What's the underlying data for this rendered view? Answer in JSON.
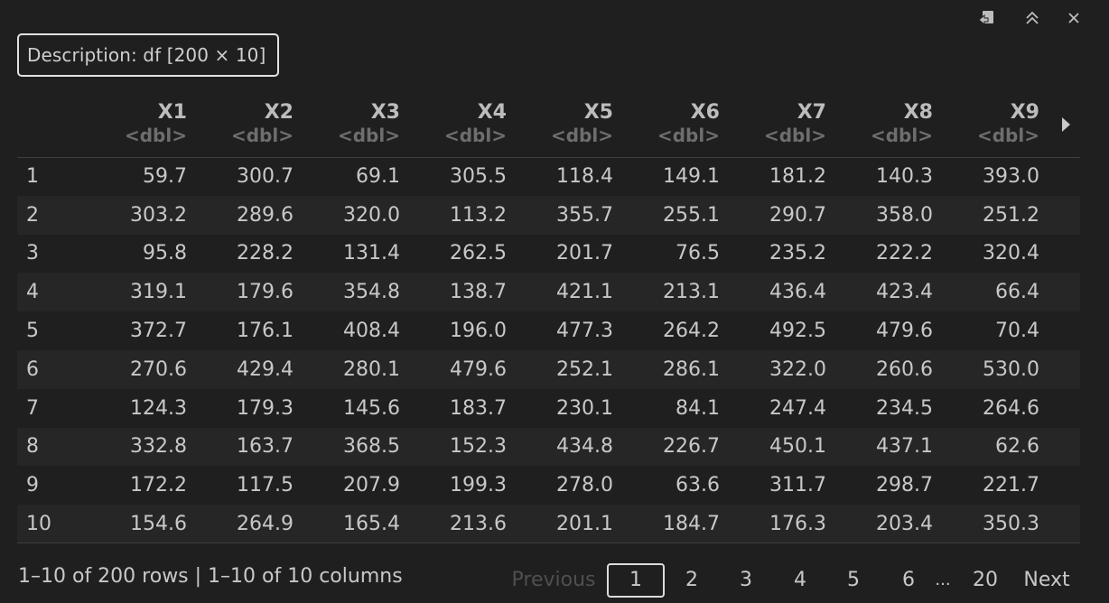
{
  "toolbar": {
    "icons": [
      "export-icon",
      "collapse-icon",
      "close-icon"
    ]
  },
  "description": "Description: df [200 × 10]",
  "columns": [
    {
      "name": "X1",
      "type": "<dbl>"
    },
    {
      "name": "X2",
      "type": "<dbl>"
    },
    {
      "name": "X3",
      "type": "<dbl>"
    },
    {
      "name": "X4",
      "type": "<dbl>"
    },
    {
      "name": "X5",
      "type": "<dbl>"
    },
    {
      "name": "X6",
      "type": "<dbl>"
    },
    {
      "name": "X7",
      "type": "<dbl>"
    },
    {
      "name": "X8",
      "type": "<dbl>"
    },
    {
      "name": "X9",
      "type": "<dbl>"
    }
  ],
  "rows": [
    {
      "name": "1",
      "values": [
        "59.7",
        "300.7",
        "69.1",
        "305.5",
        "118.4",
        "149.1",
        "181.2",
        "140.3",
        "393.0"
      ]
    },
    {
      "name": "2",
      "values": [
        "303.2",
        "289.6",
        "320.0",
        "113.2",
        "355.7",
        "255.1",
        "290.7",
        "358.0",
        "251.2"
      ]
    },
    {
      "name": "3",
      "values": [
        "95.8",
        "228.2",
        "131.4",
        "262.5",
        "201.7",
        "76.5",
        "235.2",
        "222.2",
        "320.4"
      ]
    },
    {
      "name": "4",
      "values": [
        "319.1",
        "179.6",
        "354.8",
        "138.7",
        "421.1",
        "213.1",
        "436.4",
        "423.4",
        "66.4"
      ]
    },
    {
      "name": "5",
      "values": [
        "372.7",
        "176.1",
        "408.4",
        "196.0",
        "477.3",
        "264.2",
        "492.5",
        "479.6",
        "70.4"
      ]
    },
    {
      "name": "6",
      "values": [
        "270.6",
        "429.4",
        "280.1",
        "479.6",
        "252.1",
        "286.1",
        "322.0",
        "260.6",
        "530.0"
      ]
    },
    {
      "name": "7",
      "values": [
        "124.3",
        "179.3",
        "145.6",
        "183.7",
        "230.1",
        "84.1",
        "247.4",
        "234.5",
        "264.6"
      ]
    },
    {
      "name": "8",
      "values": [
        "332.8",
        "163.7",
        "368.5",
        "152.3",
        "434.8",
        "226.7",
        "450.1",
        "437.1",
        "62.6"
      ]
    },
    {
      "name": "9",
      "values": [
        "172.2",
        "117.5",
        "207.9",
        "199.3",
        "278.0",
        "63.6",
        "311.7",
        "298.7",
        "221.7"
      ]
    },
    {
      "name": "10",
      "values": [
        "154.6",
        "264.9",
        "165.4",
        "213.6",
        "201.1",
        "184.7",
        "176.3",
        "203.4",
        "350.3"
      ]
    }
  ],
  "footer": {
    "info": "1–10 of 200 rows | 1–10 of 10 columns",
    "previous": "Previous",
    "pages": [
      "1",
      "2",
      "3",
      "4",
      "5",
      "6"
    ],
    "ellipsis": "...",
    "last_page": "20",
    "next": "Next",
    "current_page": "1"
  },
  "colors": {
    "background": "#1f1f1f",
    "row_alt": "#262626",
    "text": "#c8c8c8",
    "muted": "#6e6e6e"
  }
}
